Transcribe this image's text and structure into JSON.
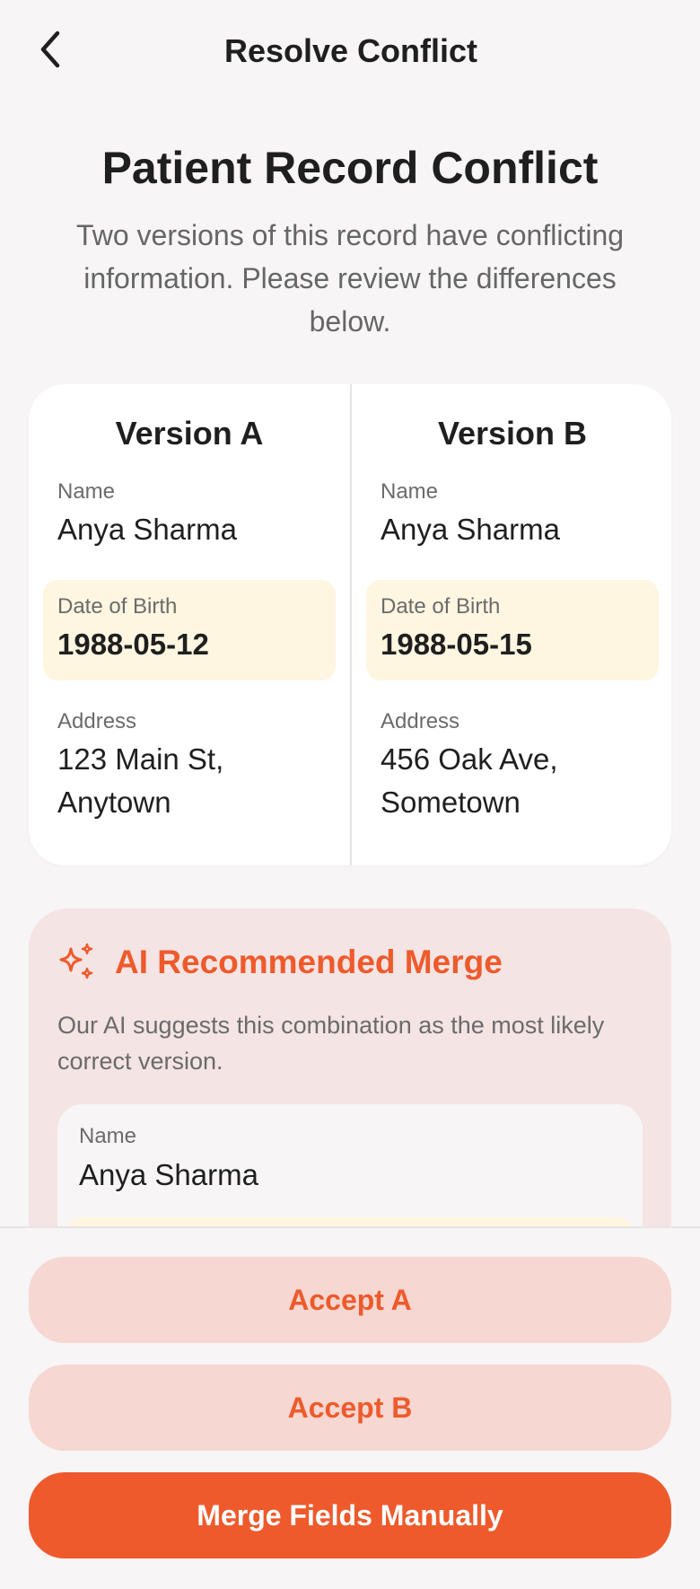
{
  "header": {
    "title": "Resolve Conflict",
    "back_icon": "chevron-left-icon"
  },
  "intro": {
    "title": "Patient Record Conflict",
    "subtitle": "Two versions of this record have conflicting information. Please review the differences below."
  },
  "versions": [
    {
      "title": "Version A",
      "fields": [
        {
          "label": "Name",
          "value": "Anya Sharma"
        },
        {
          "label": "Date of Birth",
          "value": "1988-05-12"
        },
        {
          "label": "Address",
          "value": "123 Main St, Anytown"
        }
      ]
    },
    {
      "title": "Version B",
      "fields": [
        {
          "label": "Name",
          "value": "Anya Sharma"
        },
        {
          "label": "Date of Birth",
          "value": "1988-05-15"
        },
        {
          "label": "Address",
          "value": "456 Oak Ave, Sometown"
        }
      ]
    }
  ],
  "ai": {
    "icon": "sparkle-icon",
    "title": "AI Recommended Merge",
    "description": "Our AI suggests this combination as the most likely correct version.",
    "fields": [
      {
        "label": "Name",
        "value": "Anya Sharma"
      }
    ]
  },
  "actions": {
    "accept_a": "Accept A",
    "accept_b": "Accept B",
    "merge": "Merge Fields Manually"
  },
  "colors": {
    "accent": "#EE5A2C",
    "accent_soft": "#F6D7D1",
    "highlight": "#FEF6E1",
    "ai_card_bg": "#F4E4E3"
  }
}
